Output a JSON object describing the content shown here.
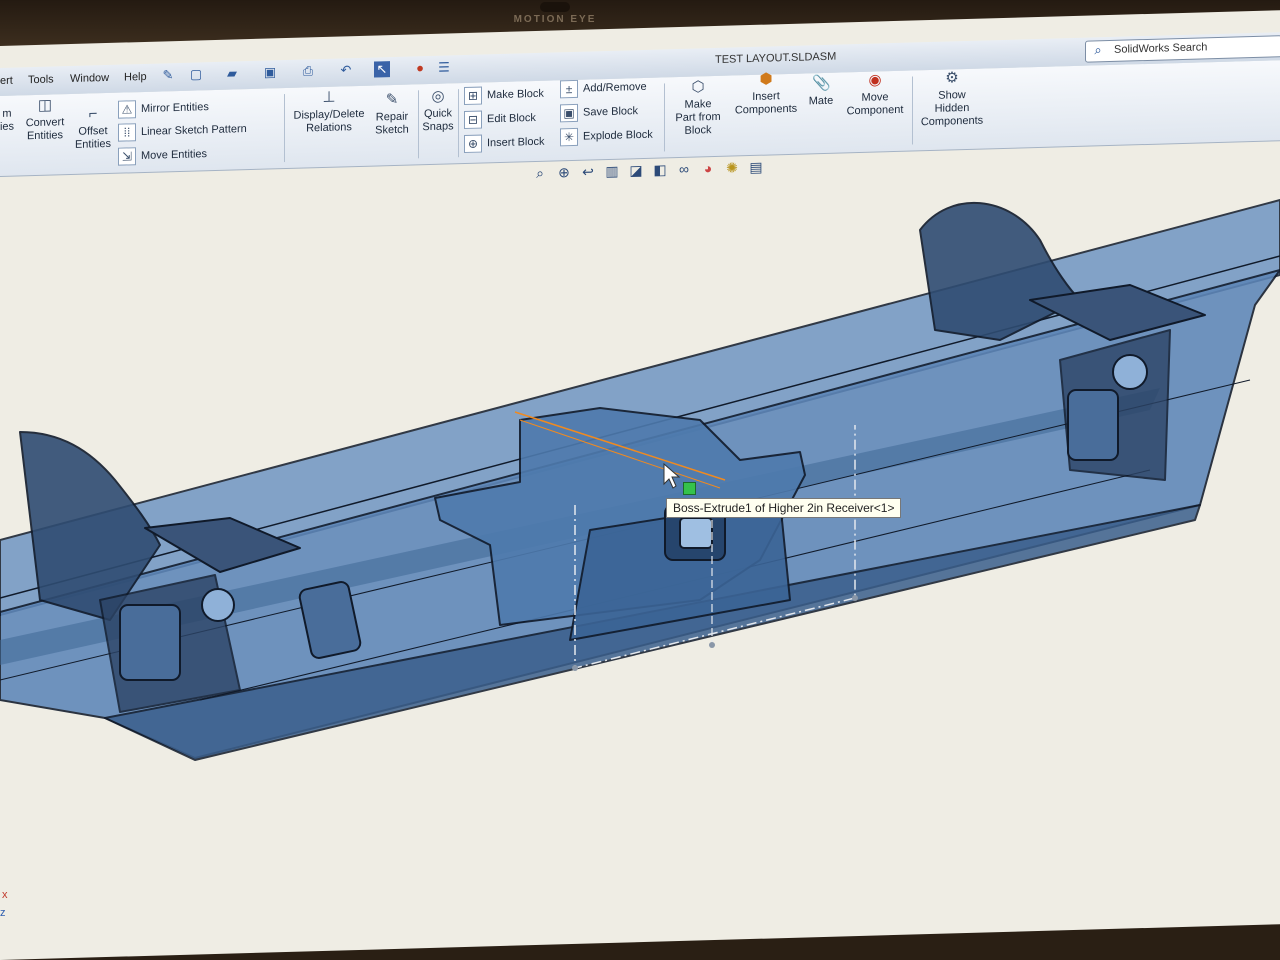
{
  "bezel": {
    "camera_label": "MOTION EYE"
  },
  "menu": [
    "ert",
    "Tools",
    "Window",
    "Help"
  ],
  "document_title": "TEST LAYOUT.SLDASM",
  "search": {
    "placeholder": "SolidWorks Search"
  },
  "ribbon": {
    "convert_entities": [
      "Convert",
      "Entities"
    ],
    "offset_entities": [
      "Offset",
      "Entities"
    ],
    "mirror_entities": "Mirror Entities",
    "linear_sketch_pattern": "Linear Sketch Pattern",
    "move_entities": "Move Entities",
    "display_delete_relations": [
      "Display/Delete",
      "Relations"
    ],
    "repair_sketch": [
      "Repair",
      "Sketch"
    ],
    "quick_snaps": [
      "Quick",
      "Snaps"
    ],
    "make_block": "Make Block",
    "edit_block": "Edit Block",
    "insert_block": "Insert Block",
    "add_remove": "Add/Remove",
    "save_block": "Save Block",
    "explode_block": "Explode Block",
    "make_part_from_block": [
      "Make",
      "Part from",
      "Block"
    ],
    "insert_components": [
      "Insert",
      "Components"
    ],
    "mate": "Mate",
    "move_component": [
      "Move",
      "Component"
    ],
    "show_hidden_components": [
      "Show",
      "Hidden",
      "Components"
    ],
    "partial_left": [
      "m",
      "ies"
    ]
  },
  "tooltip": "Boss-Extrude1 of Higher 2in Receiver<1>",
  "colors": {
    "bumper_fill": "#5d86b8",
    "bumper_edge": "#101a2a",
    "background": "#efede4"
  },
  "icons": [
    "zoom-to-fit-icon",
    "zoom-area-icon",
    "previous-view-icon",
    "section-view-icon",
    "view-orientation-icon",
    "display-style-icon",
    "hide-show-icon",
    "appearance-icon",
    "scene-icon",
    "view-settings-icon"
  ]
}
